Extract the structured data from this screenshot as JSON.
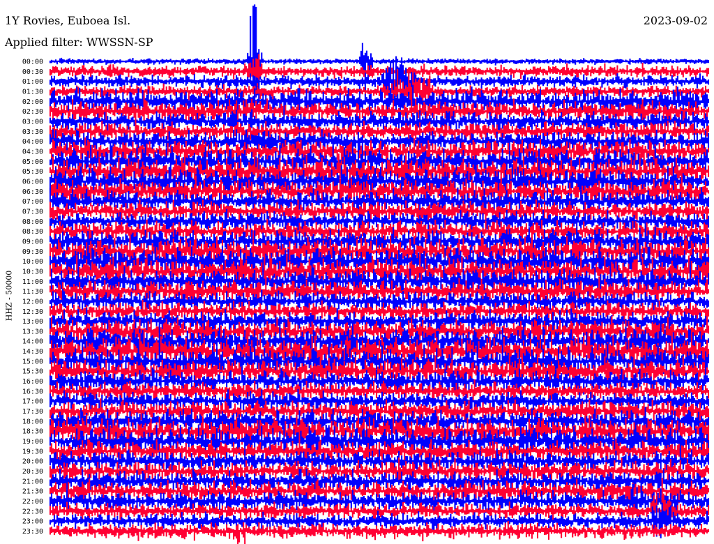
{
  "header": {
    "station": "1Y Rovies, Euboea Isl.",
    "filter": "Applied filter: WWSSN-SP",
    "date": "2023-09-02"
  },
  "colors": {
    "trace_a": "#0000ff",
    "trace_b": "#ff0033",
    "background": "#ffffff",
    "text": "#000000"
  },
  "chart_data": {
    "type": "helicorder",
    "channel_label": "HHZ - 50000",
    "row_labels": [
      "00:00",
      "00:30",
      "01:00",
      "01:30",
      "02:00",
      "02:30",
      "03:00",
      "03:30",
      "04:00",
      "04:30",
      "05:00",
      "05:30",
      "06:00",
      "06:30",
      "07:00",
      "07:30",
      "08:00",
      "08:30",
      "09:00",
      "09:30",
      "10:00",
      "10:30",
      "11:00",
      "11:30",
      "12:00",
      "12:30",
      "13:00",
      "13:30",
      "14:00",
      "14:30",
      "15:00",
      "15:30",
      "16:00",
      "16:30",
      "17:00",
      "17:30",
      "18:00",
      "18:30",
      "19:00",
      "19:30",
      "20:00",
      "20:30",
      "21:00",
      "21:30",
      "22:00",
      "22:30",
      "23:00",
      "23:30"
    ],
    "row_interval_minutes": 30,
    "trace_colors": [
      "#0000ff",
      "#ff0033"
    ],
    "x_axis": "minutes within row",
    "x_range_minutes": [
      0,
      30
    ],
    "grid": false,
    "legend": "none"
  }
}
